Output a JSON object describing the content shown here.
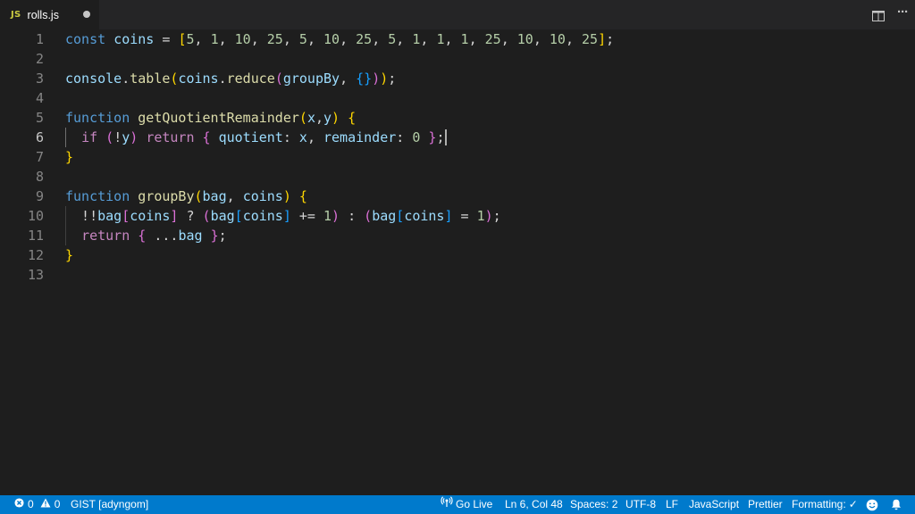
{
  "tab": {
    "icon_text": "JS",
    "title": "rolls.js",
    "modified": true
  },
  "tab_actions": {
    "split_icon": "split-editor-icon",
    "more_label": "···"
  },
  "editor": {
    "active_line": 6,
    "lines": [
      {
        "number": "1"
      },
      {
        "number": "2"
      },
      {
        "number": "3"
      },
      {
        "number": "4"
      },
      {
        "number": "5"
      },
      {
        "number": "6"
      },
      {
        "number": "7"
      },
      {
        "number": "8"
      },
      {
        "number": "9"
      },
      {
        "number": "10"
      },
      {
        "number": "11"
      },
      {
        "number": "12"
      },
      {
        "number": "13"
      }
    ],
    "code": [
      [
        [
          "kw",
          "const"
        ],
        [
          "pun",
          " "
        ],
        [
          "var",
          "coins"
        ],
        [
          "pun",
          " = "
        ],
        [
          "b1",
          "["
        ],
        [
          "num",
          "5"
        ],
        [
          "pun",
          ", "
        ],
        [
          "num",
          "1"
        ],
        [
          "pun",
          ", "
        ],
        [
          "num",
          "10"
        ],
        [
          "pun",
          ", "
        ],
        [
          "num",
          "25"
        ],
        [
          "pun",
          ", "
        ],
        [
          "num",
          "5"
        ],
        [
          "pun",
          ", "
        ],
        [
          "num",
          "10"
        ],
        [
          "pun",
          ", "
        ],
        [
          "num",
          "25"
        ],
        [
          "pun",
          ", "
        ],
        [
          "num",
          "5"
        ],
        [
          "pun",
          ", "
        ],
        [
          "num",
          "1"
        ],
        [
          "pun",
          ", "
        ],
        [
          "num",
          "1"
        ],
        [
          "pun",
          ", "
        ],
        [
          "num",
          "1"
        ],
        [
          "pun",
          ", "
        ],
        [
          "num",
          "25"
        ],
        [
          "pun",
          ", "
        ],
        [
          "num",
          "10"
        ],
        [
          "pun",
          ", "
        ],
        [
          "num",
          "10"
        ],
        [
          "pun",
          ", "
        ],
        [
          "num",
          "25"
        ],
        [
          "b1",
          "]"
        ],
        [
          "pun",
          ";"
        ]
      ],
      [],
      [
        [
          "var",
          "console"
        ],
        [
          "pun",
          "."
        ],
        [
          "fn",
          "table"
        ],
        [
          "b1",
          "("
        ],
        [
          "var",
          "coins"
        ],
        [
          "pun",
          "."
        ],
        [
          "fn",
          "reduce"
        ],
        [
          "b2",
          "("
        ],
        [
          "var",
          "groupBy"
        ],
        [
          "pun",
          ", "
        ],
        [
          "b3",
          "{}"
        ],
        [
          "b2",
          ")"
        ],
        [
          "b1",
          ")"
        ],
        [
          "pun",
          ";"
        ]
      ],
      [],
      [
        [
          "kw",
          "function"
        ],
        [
          "pun",
          " "
        ],
        [
          "fn",
          "getQuotientRemainder"
        ],
        [
          "b1",
          "("
        ],
        [
          "var",
          "x"
        ],
        [
          "pun",
          ","
        ],
        [
          "var",
          "y"
        ],
        [
          "b1",
          ")"
        ],
        [
          "pun",
          " "
        ],
        [
          "b1",
          "{"
        ]
      ],
      [
        [
          "pun",
          "  "
        ],
        [
          "kw2",
          "if"
        ],
        [
          "pun",
          " "
        ],
        [
          "b2",
          "("
        ],
        [
          "pun",
          "!"
        ],
        [
          "var",
          "y"
        ],
        [
          "b2",
          ")"
        ],
        [
          "pun",
          " "
        ],
        [
          "kw2",
          "return"
        ],
        [
          "pun",
          " "
        ],
        [
          "b2",
          "{"
        ],
        [
          "pun",
          " "
        ],
        [
          "var",
          "quotient"
        ],
        [
          "pun",
          ": "
        ],
        [
          "var",
          "x"
        ],
        [
          "pun",
          ", "
        ],
        [
          "var",
          "remainder"
        ],
        [
          "pun",
          ": "
        ],
        [
          "num",
          "0"
        ],
        [
          "pun",
          " "
        ],
        [
          "b2",
          "}"
        ],
        [
          "pun",
          ";"
        ]
      ],
      [
        [
          "b1",
          "}"
        ]
      ],
      [],
      [
        [
          "kw",
          "function"
        ],
        [
          "pun",
          " "
        ],
        [
          "fn",
          "groupBy"
        ],
        [
          "b1",
          "("
        ],
        [
          "var",
          "bag"
        ],
        [
          "pun",
          ", "
        ],
        [
          "var",
          "coins"
        ],
        [
          "b1",
          ")"
        ],
        [
          "pun",
          " "
        ],
        [
          "b1",
          "{"
        ]
      ],
      [
        [
          "pun",
          "  !!"
        ],
        [
          "var",
          "bag"
        ],
        [
          "b2",
          "["
        ],
        [
          "var",
          "coins"
        ],
        [
          "b2",
          "]"
        ],
        [
          "pun",
          " ? "
        ],
        [
          "b2",
          "("
        ],
        [
          "var",
          "bag"
        ],
        [
          "b3",
          "["
        ],
        [
          "var",
          "coins"
        ],
        [
          "b3",
          "]"
        ],
        [
          "pun",
          " += "
        ],
        [
          "num",
          "1"
        ],
        [
          "b2",
          ")"
        ],
        [
          "pun",
          " : "
        ],
        [
          "b2",
          "("
        ],
        [
          "var",
          "bag"
        ],
        [
          "b3",
          "["
        ],
        [
          "var",
          "coins"
        ],
        [
          "b3",
          "]"
        ],
        [
          "pun",
          " = "
        ],
        [
          "num",
          "1"
        ],
        [
          "b2",
          ")"
        ],
        [
          "pun",
          ";"
        ]
      ],
      [
        [
          "pun",
          "  "
        ],
        [
          "kw2",
          "return"
        ],
        [
          "pun",
          " "
        ],
        [
          "b2",
          "{"
        ],
        [
          "pun",
          " ..."
        ],
        [
          "var",
          "bag"
        ],
        [
          "pun",
          " "
        ],
        [
          "b2",
          "}"
        ],
        [
          "pun",
          ";"
        ]
      ],
      [
        [
          "b1",
          "}"
        ]
      ],
      []
    ]
  },
  "statusbar": {
    "errors": "0",
    "warnings": "0",
    "gist": "GIST [adyngom]",
    "go_live": "Go Live",
    "position": "Ln 6, Col 48",
    "spaces": "Spaces: 2",
    "encoding": "UTF-8",
    "eol": "LF",
    "language": "JavaScript",
    "prettier": "Prettier",
    "formatting": "Formatting:",
    "formatting_status": "✓"
  },
  "colors": {
    "editor_bg": "#1e1e1e",
    "statusbar_bg": "#007acc",
    "keyword": "#569cd6",
    "control": "#c586c0",
    "variable": "#9cdcfe",
    "function": "#dcdcaa",
    "number": "#b5cea8"
  }
}
